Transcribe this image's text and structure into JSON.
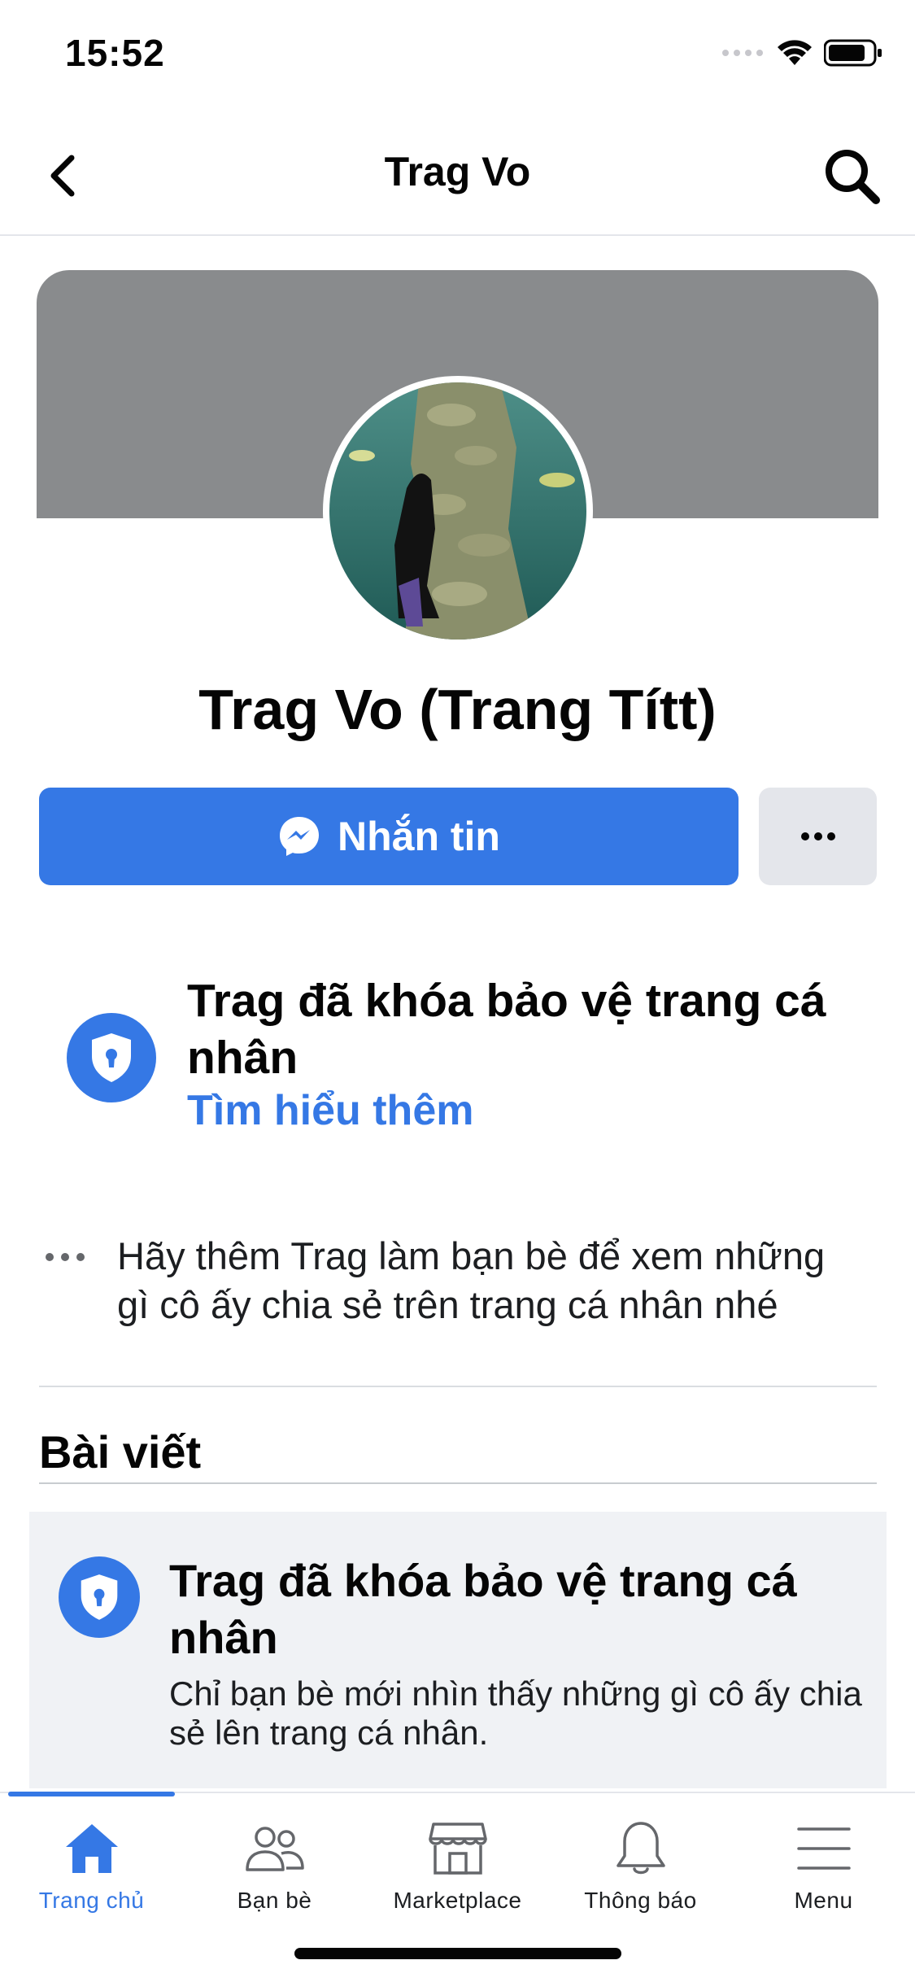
{
  "status": {
    "time": "15:52"
  },
  "nav": {
    "title": "Trag Vo"
  },
  "profile": {
    "name": "Trag Vo (Trang Títt)"
  },
  "actions": {
    "message_label": "Nhắn tin"
  },
  "lock_notice": {
    "title": "Trag đã khóa bảo vệ trang cá nhân",
    "link": "Tìm hiểu thêm"
  },
  "add_friend": {
    "text": "Hãy thêm Trag làm bạn bè để xem những gì cô ấy chia sẻ trên trang cá nhân nhé"
  },
  "posts": {
    "header": "Bài viết",
    "card_title": "Trag đã khóa bảo vệ trang cá nhân",
    "card_text": "Chỉ bạn bè mới nhìn thấy những gì cô ấy chia sẻ lên trang cá nhân."
  },
  "tabs": [
    {
      "label": "Trang chủ",
      "icon": "home-icon",
      "active": true
    },
    {
      "label": "Bạn bè",
      "icon": "friends-icon",
      "active": false
    },
    {
      "label": "Marketplace",
      "icon": "marketplace-icon",
      "active": false
    },
    {
      "label": "Thông báo",
      "icon": "bell-icon",
      "active": false
    },
    {
      "label": "Menu",
      "icon": "menu-icon",
      "active": false
    }
  ],
  "colors": {
    "accent": "#3578e5",
    "cover": "#898b8d",
    "card_bg": "#f0f2f5"
  }
}
